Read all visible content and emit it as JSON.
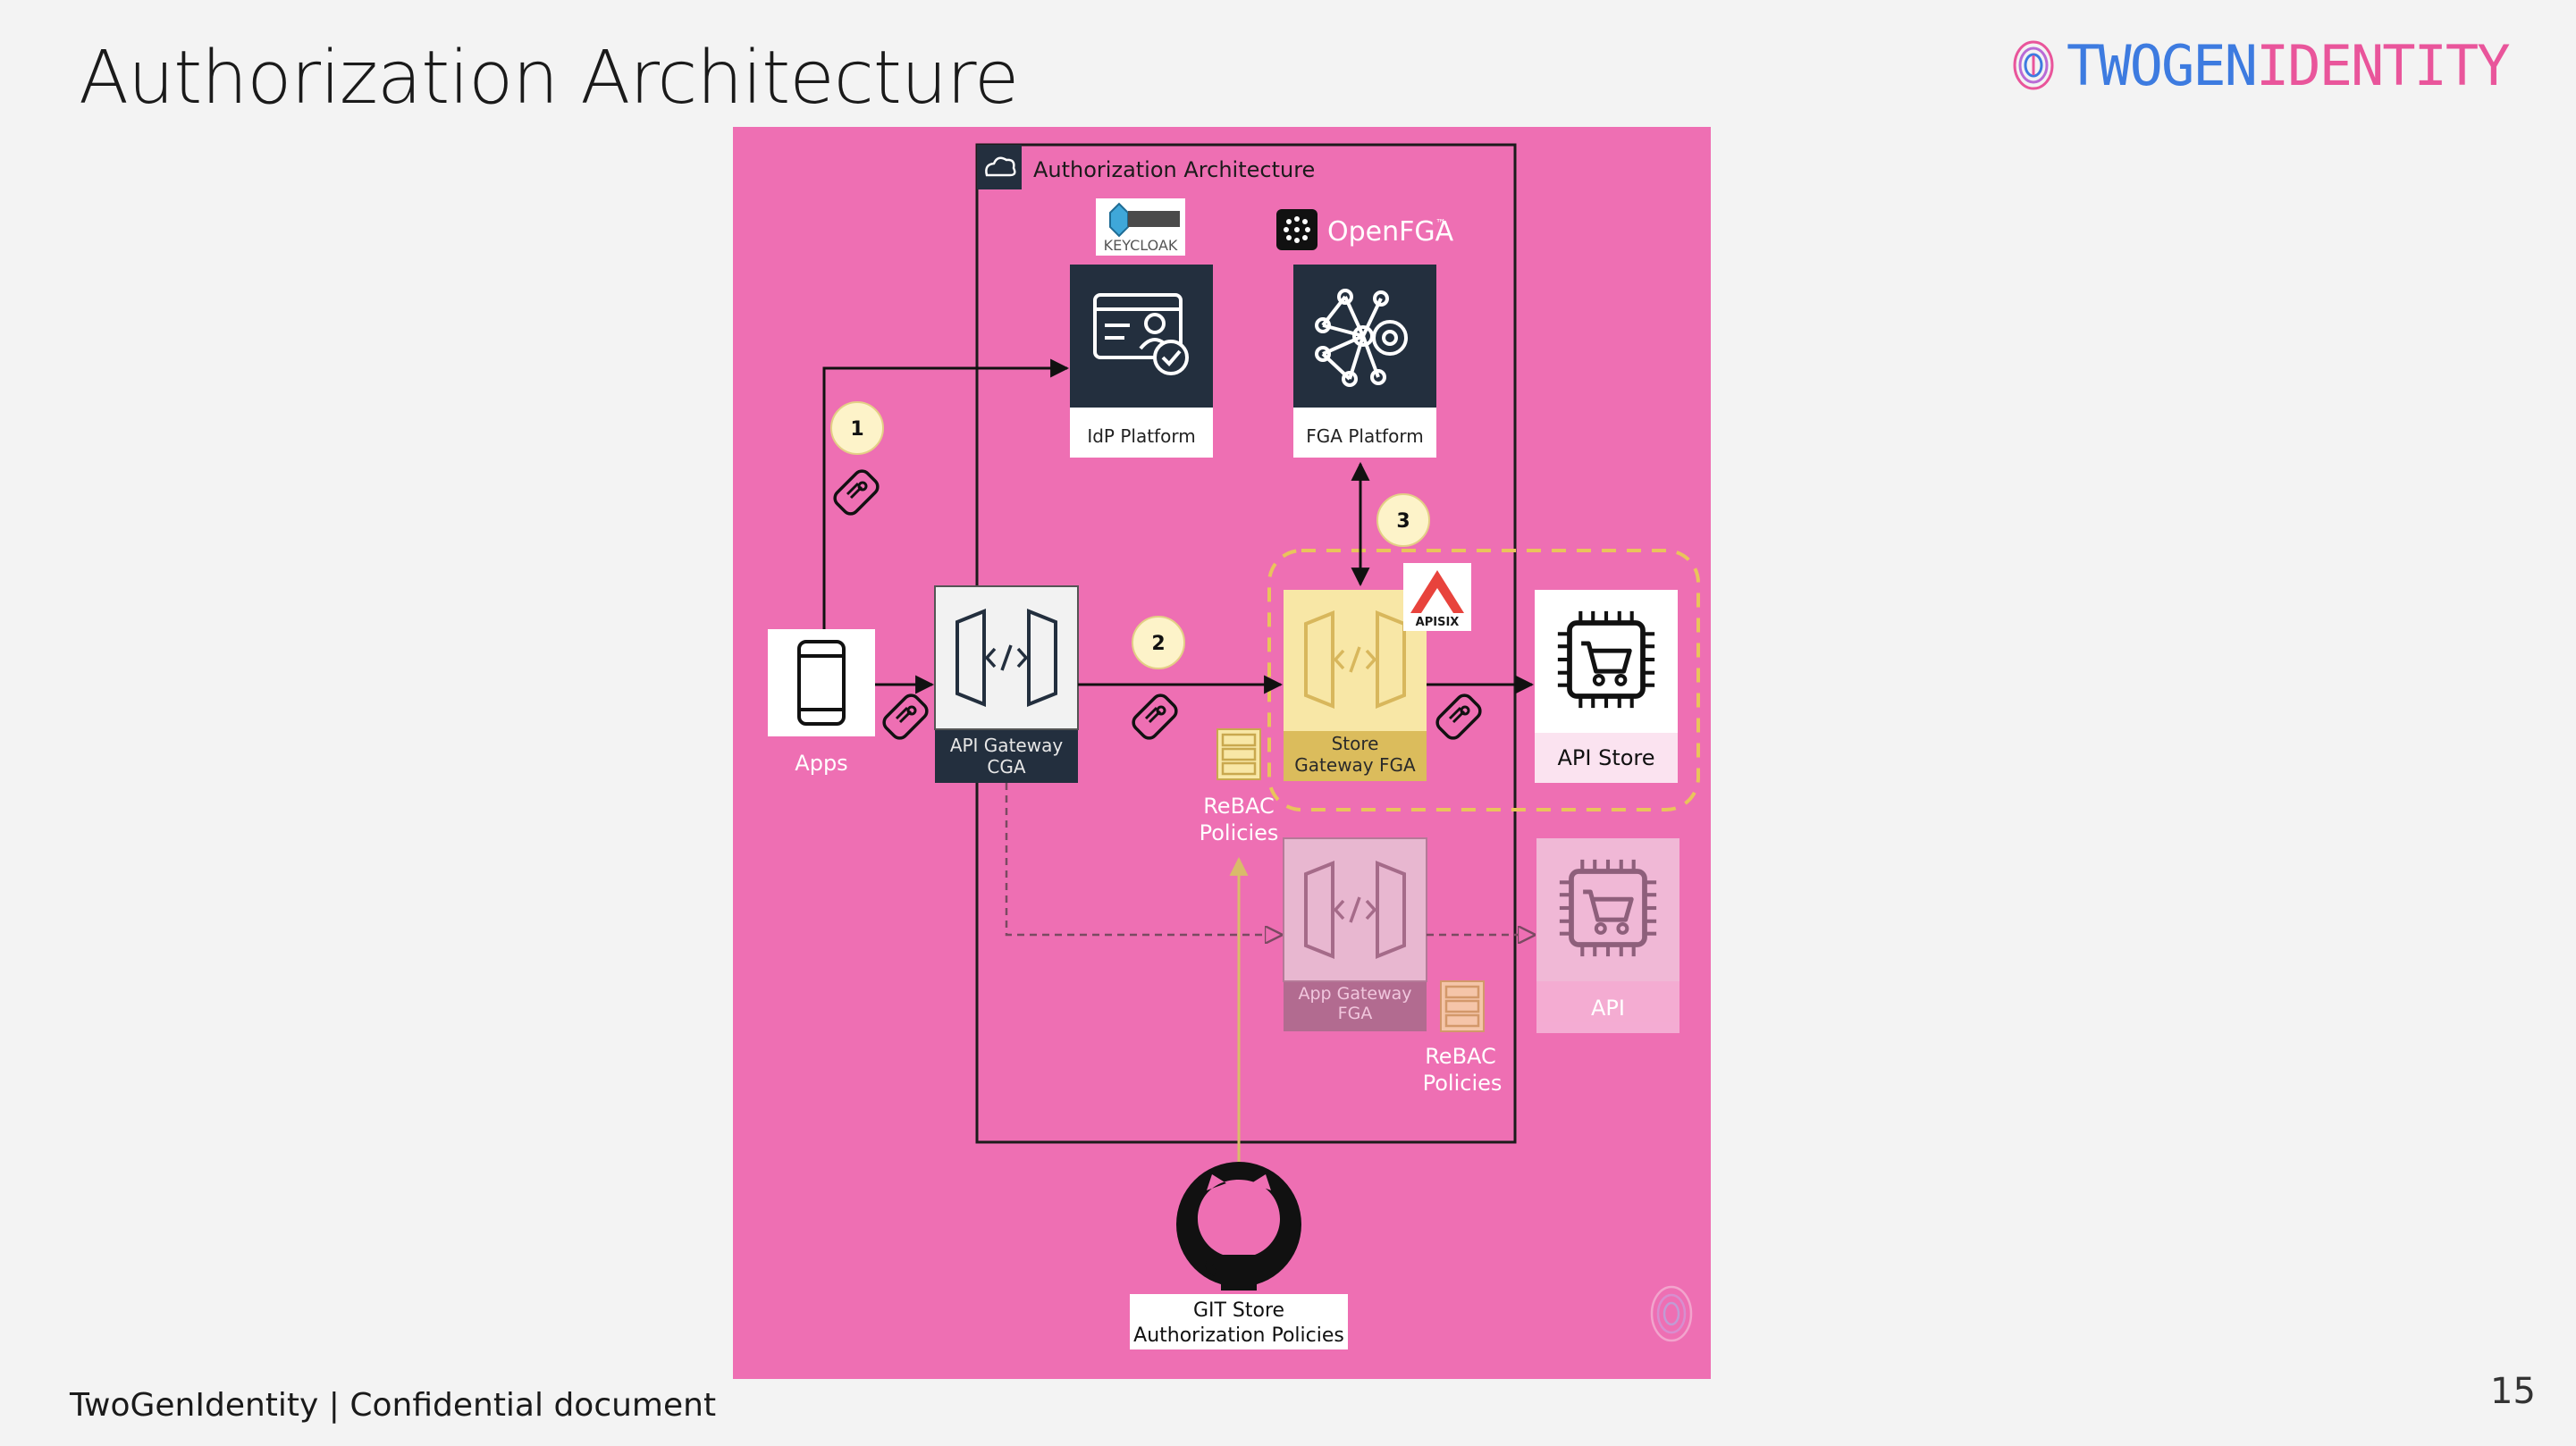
{
  "slide": {
    "title": "Authorization Architecture",
    "footer": "TwoGenIdentity | Confidential document",
    "page_number": "15",
    "brand_two": "TWOGEN",
    "brand_identity": "IDENTITY"
  },
  "diagram": {
    "frame_title": "Authorization Architecture",
    "keycloak_logo_text": "KEYCLOAK",
    "openfga_logo_text": "OpenFGA",
    "openfga_tm": "™",
    "apisix_logo_text": "APISIX",
    "idp_label": "IdP Platform",
    "fga_label": "FGA Platform",
    "apps_label": "Apps",
    "api_gateway_line1": "API Gateway",
    "api_gateway_line2": "CGA",
    "store_gateway_line1": "Store",
    "store_gateway_line2": "Gateway FGA",
    "api_store_label": "API Store",
    "rebac_1_line1": "ReBAC",
    "rebac_1_line2": "Policies",
    "rebac_2_line1": "ReBAC",
    "rebac_2_line2": "Policies",
    "app_gateway_line1": "App Gateway",
    "app_gateway_line2": "FGA",
    "api_label": "API",
    "git_line1": "GIT Store",
    "git_line2": "Authorization Policies",
    "step_1": "1",
    "step_2": "2",
    "step_3": "3"
  },
  "colors": {
    "background": "#f3f3f3",
    "canvas": "#ee6fb3",
    "dark_tile": "#232f3e",
    "store_gateway": "#f8e7a6",
    "store_gateway_label": "#dbbc5c",
    "step_badge": "#fdf3c9",
    "dashed_highlight": "#e9c45b",
    "brand_blue": "#3d7be0",
    "brand_pink": "#e9559b"
  }
}
